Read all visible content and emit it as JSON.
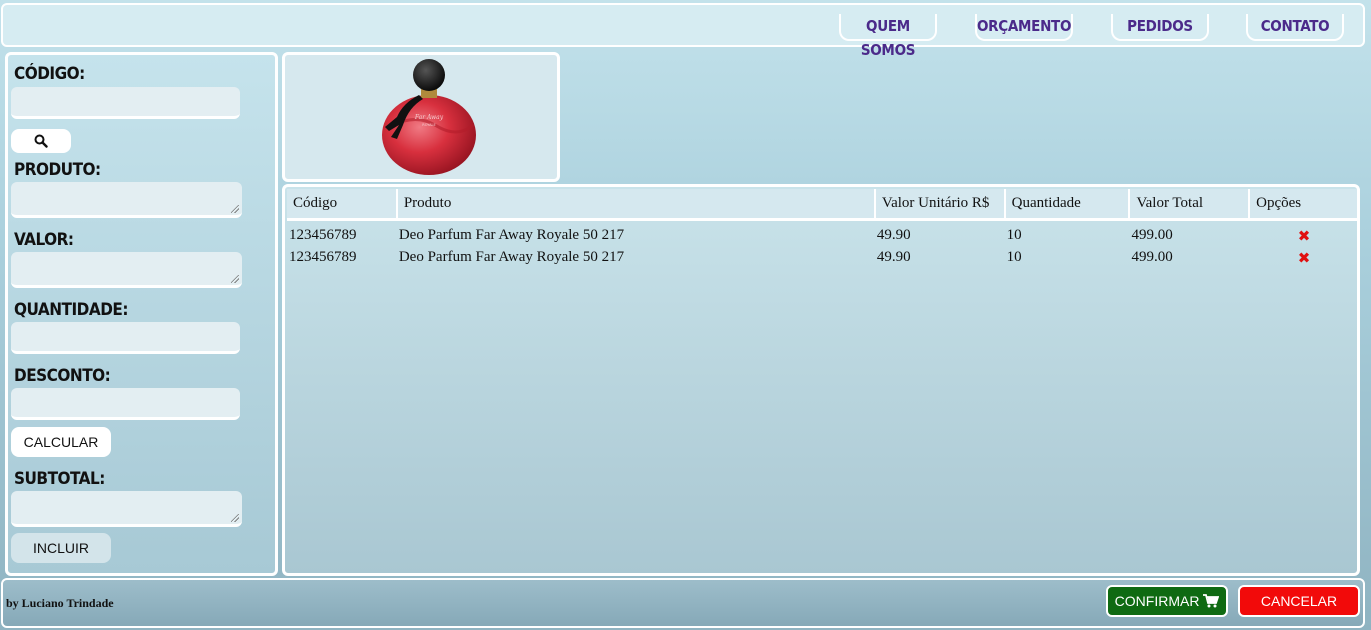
{
  "nav": {
    "items": [
      "QUEM SOMOS",
      "ORÇAMENTO",
      "PEDIDOS",
      "CONTATO"
    ]
  },
  "form": {
    "codigo_label": "CÓDIGO:",
    "produto_label": "PRODUTO:",
    "valor_label": "VALOR:",
    "quantidade_label": "QUANTIDADE:",
    "desconto_label": "DESCONTO:",
    "calcular_label": "CALCULAR",
    "subtotal_label": "SUBTOTAL:",
    "incluir_label": "INCLUIR",
    "search_icon": "search-icon"
  },
  "product_image": {
    "alt": "perfume-bottle"
  },
  "table": {
    "headers": [
      "Código",
      "Produto",
      "Valor Unitário R$",
      "Quantidade",
      "Valor Total",
      "Opções"
    ],
    "rows": [
      {
        "codigo": "123456789",
        "produto": "Deo Parfum Far Away Royale 50 217",
        "valor": "49.90",
        "quantidade": "10",
        "total": "499.00",
        "opcao": "✖"
      },
      {
        "codigo": "123456789",
        "produto": "Deo Parfum Far Away Royale 50 217",
        "valor": "49.90",
        "quantidade": "10",
        "total": "499.00",
        "opcao": "✖"
      }
    ]
  },
  "footer": {
    "author": "by Luciano Trindade",
    "confirmar_label": "CONFIRMAR",
    "cancelar_label": "CANCELAR"
  },
  "colors": {
    "nav_text": "#4b2a8a",
    "confirm": "#0f6a12",
    "cancel": "#f20a0a",
    "delete": "#e01010"
  }
}
